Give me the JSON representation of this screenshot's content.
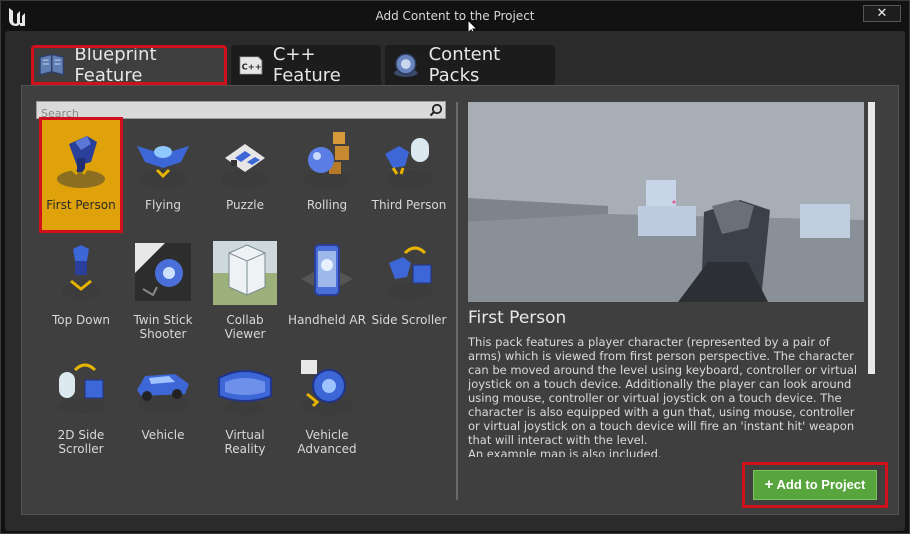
{
  "window": {
    "title": "Add Content to the Project",
    "close_label": "✕"
  },
  "tabs": [
    {
      "label": "Blueprint Feature",
      "selected": true
    },
    {
      "label": "C++ Feature",
      "selected": false
    },
    {
      "label": "Content Packs",
      "selected": false
    }
  ],
  "search": {
    "placeholder": "Search",
    "value": ""
  },
  "templates": [
    {
      "label": "First Person",
      "icon": "first-person-icon",
      "selected": true
    },
    {
      "label": "Flying",
      "icon": "flying-icon"
    },
    {
      "label": "Puzzle",
      "icon": "puzzle-icon"
    },
    {
      "label": "Rolling",
      "icon": "rolling-icon"
    },
    {
      "label": "Third Person",
      "icon": "third-person-icon"
    },
    {
      "label": "Top Down",
      "icon": "top-down-icon"
    },
    {
      "label": "Twin Stick Shooter",
      "icon": "twin-stick-icon"
    },
    {
      "label": "Collab Viewer",
      "icon": "collab-viewer-icon"
    },
    {
      "label": "Handheld AR",
      "icon": "handheld-ar-icon"
    },
    {
      "label": "Side Scroller",
      "icon": "side-scroller-icon"
    },
    {
      "label": "2D Side Scroller",
      "icon": "2d-side-scroller-icon"
    },
    {
      "label": "Vehicle",
      "icon": "vehicle-icon"
    },
    {
      "label": "Virtual Reality",
      "icon": "vr-icon"
    },
    {
      "label": "Vehicle Advanced",
      "icon": "vehicle-advanced-icon"
    }
  ],
  "details": {
    "title": "First Person",
    "description": "This pack features a player character (represented by a pair of arms) which is viewed from first person perspective. The character can be moved around the level using keyboard, controller or virtual joystick on a touch device. Additionally the player can look around using mouse, controller or virtual joystick on a touch device. The character is also equipped with a gun that, using mouse, controller or virtual joystick on a touch device will fire an 'instant hit' weapon that will interact with the level.",
    "description_extra": "An example map is also included."
  },
  "add_button": {
    "plus": "+",
    "label": "Add to Project"
  },
  "colors": {
    "selected_tile": "#dfa20b",
    "highlight_red": "#d0101b",
    "add_button": "#58a53d"
  }
}
